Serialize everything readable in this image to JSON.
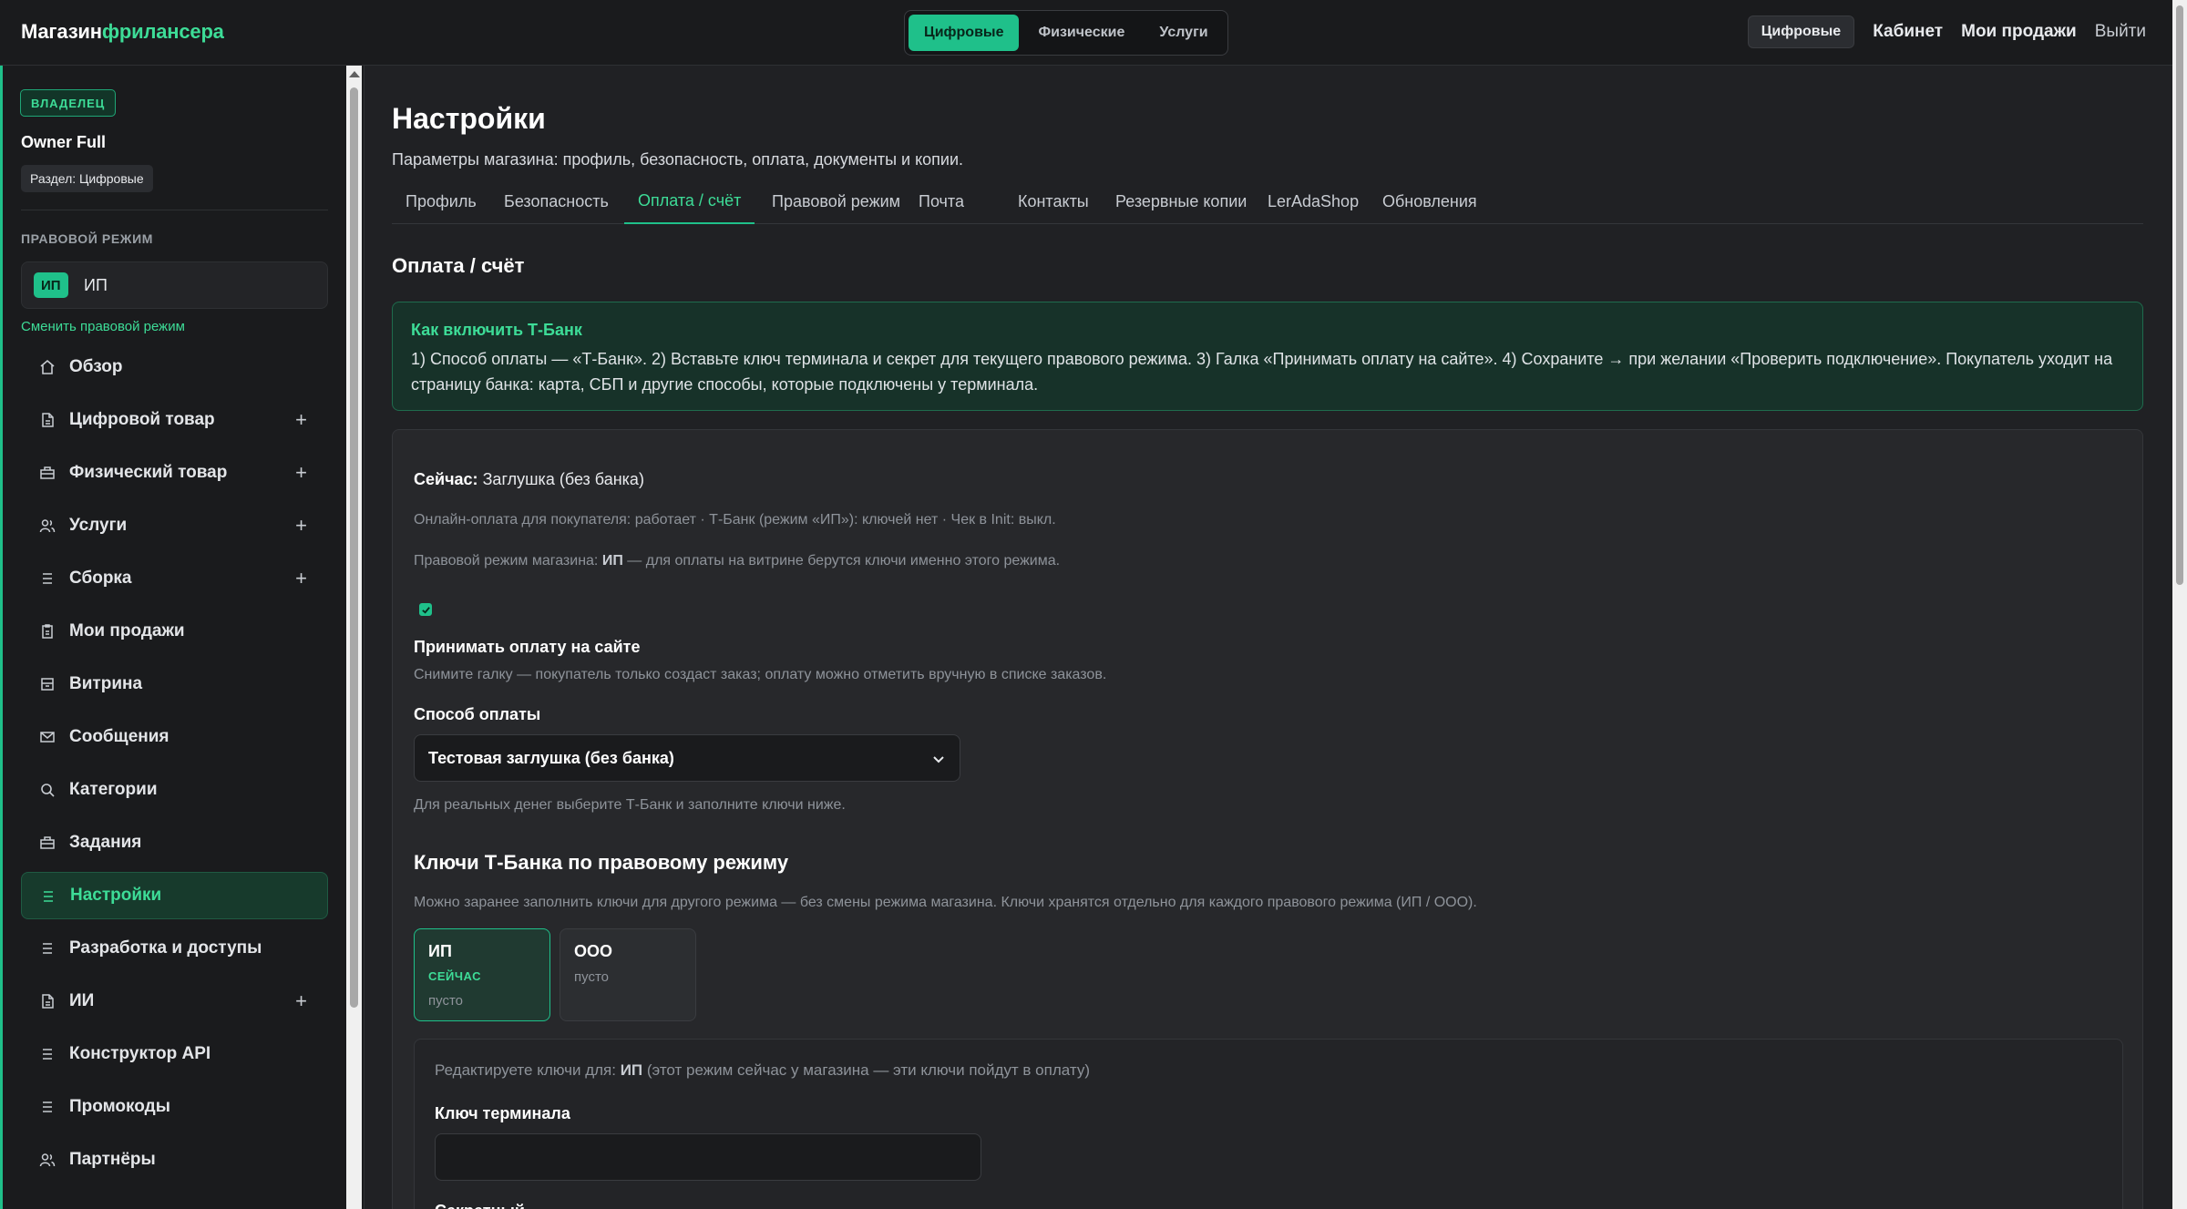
{
  "logo": {
    "part1": "Магазин",
    "part2": "фрилансера"
  },
  "top_tabs": [
    {
      "label": "Цифровые",
      "active": true
    },
    {
      "label": "Физические",
      "active": false
    },
    {
      "label": "Услуги",
      "active": false
    }
  ],
  "top_right": {
    "current": "Цифровые",
    "cabinet": "Кабинет",
    "my_sales": "Мои продажи",
    "logout": "Выйти"
  },
  "sidebar": {
    "owner_badge": "ВЛАДЕЛЕЦ",
    "owner_name": "Owner Full",
    "section": "Раздел: Цифровые",
    "legal_heading": "ПРАВОВОЙ РЕЖИМ",
    "legal_tag": "ИП",
    "legal_value": "ИП",
    "change_link": "Сменить правовой режим",
    "items": [
      {
        "label": "Обзор",
        "icon": "home-icon",
        "plus": false,
        "active": false
      },
      {
        "label": "Цифровой товар",
        "icon": "file-icon",
        "plus": true,
        "active": false
      },
      {
        "label": "Физический товар",
        "icon": "box-icon",
        "plus": true,
        "active": false
      },
      {
        "label": "Услуги",
        "icon": "users-icon",
        "plus": true,
        "active": false
      },
      {
        "label": "Сборка",
        "icon": "list-icon",
        "plus": true,
        "active": false
      },
      {
        "label": "Мои продажи",
        "icon": "clipboard-icon",
        "plus": false,
        "active": false
      },
      {
        "label": "Витрина",
        "icon": "storefront-icon",
        "plus": false,
        "active": false
      },
      {
        "label": "Сообщения",
        "icon": "mail-icon",
        "plus": false,
        "active": false
      },
      {
        "label": "Категории",
        "icon": "search-icon",
        "plus": false,
        "active": false
      },
      {
        "label": "Задания",
        "icon": "briefcase-icon",
        "plus": false,
        "active": false
      },
      {
        "label": "Настройки",
        "icon": "list-icon",
        "plus": false,
        "active": true
      },
      {
        "label": "Разработка и доступы",
        "icon": "list-icon",
        "plus": false,
        "active": false
      },
      {
        "label": "ИИ",
        "icon": "file-icon",
        "plus": true,
        "active": false
      },
      {
        "label": "Конструктор API",
        "icon": "list-icon",
        "plus": false,
        "active": false
      },
      {
        "label": "Промокоды",
        "icon": "list-icon",
        "plus": false,
        "active": false
      },
      {
        "label": "Партнёры",
        "icon": "users-icon",
        "plus": false,
        "active": false
      }
    ]
  },
  "main": {
    "title": "Настройки",
    "subtitle": "Параметры магазина: профиль, безопасность, оплата, документы и копии.",
    "tabs": [
      {
        "label": "Профиль",
        "active": false
      },
      {
        "label": "Безопасность",
        "active": false
      },
      {
        "label": "Оплата / счёт",
        "active": true
      },
      {
        "label": "Правовой режим",
        "active": false
      },
      {
        "label": "Почта",
        "active": false
      },
      {
        "label": "Контакты",
        "active": false
      },
      {
        "label": "Резервные копии",
        "active": false
      },
      {
        "label": "LerAdaShop",
        "active": false
      },
      {
        "label": "Обновления",
        "active": false
      }
    ],
    "section_title": "Оплата / счёт",
    "info": {
      "title": "Как включить Т-Банк",
      "text": "1) Способ оплаты — «Т-Банк». 2) Вставьте ключ терминала и секрет для текущего правового режима. 3) Галка «Принимать оплату на сайте». 4) Сохраните → при желании «Проверить подключение». Покупатель уходит на страницу банка: карта, СБП и другие способы, которые подключены у терминала."
    },
    "card": {
      "now_label": "Сейчас:",
      "now_value": "Заглушка (без банка)",
      "online_line": "Онлайн-оплата для покупателя: работает · Т-Банк (режим «ИП»): ключей нет · Чек в Init: выкл.",
      "legal_line_prefix": "Правовой режим магазина:",
      "legal_line_mode": "ИП",
      "legal_line_suffix": "— для оплаты на витрине берутся ключи именно этого режима.",
      "accept_checked": true,
      "accept_label": "Принимать оплату на сайте",
      "accept_hint": "Снимите галку — покупатель только создаст заказ; оплату можно отметить вручную в списке заказов.",
      "method_label": "Способ оплаты",
      "method_value": "Тестовая заглушка (без банка)",
      "method_hint": "Для реальных денег выберите Т-Банк и заполните ключи ниже.",
      "keys_title": "Ключи Т-Банка по правовому режиму",
      "keys_hint": "Можно заранее заполнить ключи для другого режима — без смены режима магазина. Ключи хранятся отдельно для каждого правового режима (ИП / ООО).",
      "modes": [
        {
          "name": "ИП",
          "now": "СЕЙЧАС",
          "state": "пусто",
          "active": true
        },
        {
          "name": "ООО",
          "now": "",
          "state": "пусто",
          "active": false
        }
      ],
      "edit_prefix": "Редактируете ключи для:",
      "edit_mode": "ИП",
      "edit_suffix": "(этот режим сейчас у магазина — эти ключи пойдут в оплату)",
      "terminal_key_label": "Ключ терминала",
      "terminal_key_value": "",
      "secret_label": "Секретный..."
    }
  },
  "colors": {
    "accent": "#1fc08a",
    "accent_text": "#3ddc97",
    "bg": "#202124",
    "panel": "#1a1b1d"
  }
}
